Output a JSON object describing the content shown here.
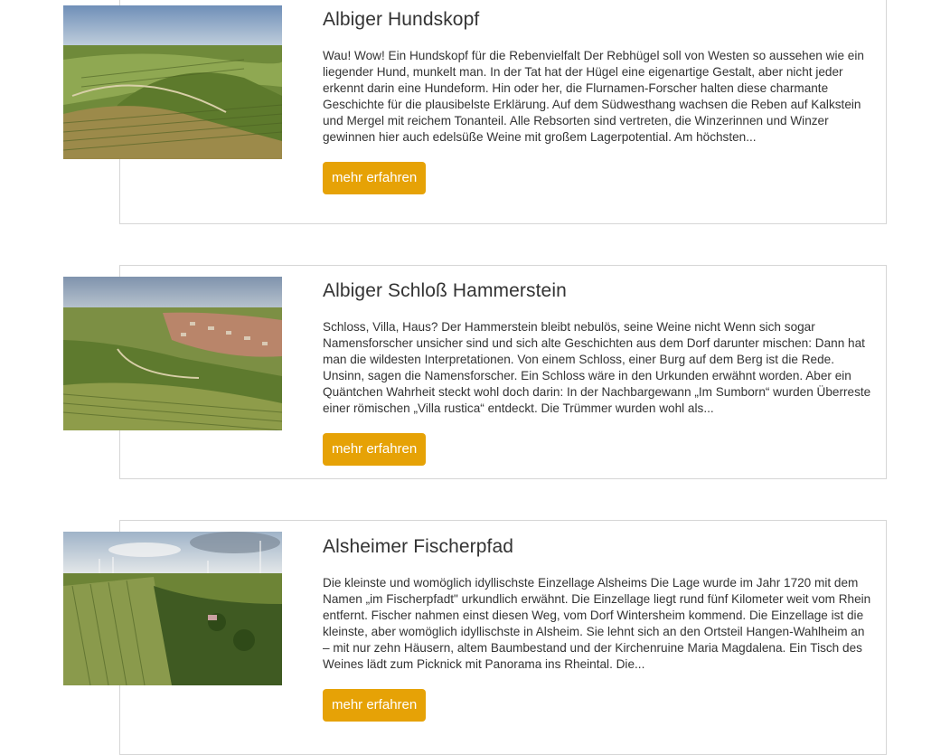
{
  "items": [
    {
      "title": "Albiger Hundskopf",
      "text": "Wau! Wow! Ein Hundskopf für die Rebenvielfalt Der Rebhügel soll von Westen so aussehen wie ein liegender Hund, munkelt man. In der Tat hat der Hügel eine eigenartige Gestalt, aber nicht jeder erkennt darin eine Hundeform. Hin oder her, die Flurnamen-Forscher halten diese charmante Geschichte für die plausibelste Erklärung. Auf dem Südwesthang wachsen die Reben auf Kalkstein und Mergel mit reichem Tonanteil. Alle Rebsorten sind vertreten, die Winzerinnen und Winzer gewinnen hier auch edelsüße Weine mit großem Lagerpotential. Am höchsten...",
      "button": "mehr erfahren"
    },
    {
      "title": "Albiger Schloß Hammerstein",
      "text": "Schloss, Villa, Haus? Der Hammerstein bleibt nebulös, seine Weine nicht Wenn sich sogar Namensforscher unsicher sind und sich alte Geschichten aus dem Dorf darunter mischen: Dann hat man die wildesten Interpretationen. Von einem Schloss, einer Burg auf dem Berg ist die Rede. Unsinn, sagen die Namensforscher. Ein Schloss wäre in den Urkunden erwähnt worden. Aber ein Quäntchen Wahrheit steckt wohl doch darin: In der Nachbargewann „Im Sumborn“ wurden Überreste einer römischen „Villa rustica“ entdeckt. Die Trümmer wurden wohl als...",
      "button": "mehr erfahren"
    },
    {
      "title": "Alsheimer Fischerpfad",
      "text": "Die kleinste und womöglich idyllischste Einzellage Alsheims Die Lage wurde im Jahr 1720 mit dem Namen „im Fischerpfadt\" urkundlich erwähnt. Die Einzellage liegt rund fünf Kilometer weit vom Rhein entfernt. Fischer nahmen einst diesen Weg, vom Dorf Wintersheim kommend. Die Einzellage ist die kleinste, aber womöglich idyllischste in Alsheim. Sie lehnt sich an den Ortsteil Hangen-Wahlheim an – mit nur zehn Häusern, altem Baumbestand und der Kirchenruine Maria Magdalena. Ein Tisch des Weines lädt zum Picknick mit Panorama ins Rheintal. Die...",
      "button": "mehr erfahren"
    }
  ],
  "colors": {
    "button_bg": "#e6a206",
    "border": "#d6d6d6",
    "text": "#333333"
  }
}
